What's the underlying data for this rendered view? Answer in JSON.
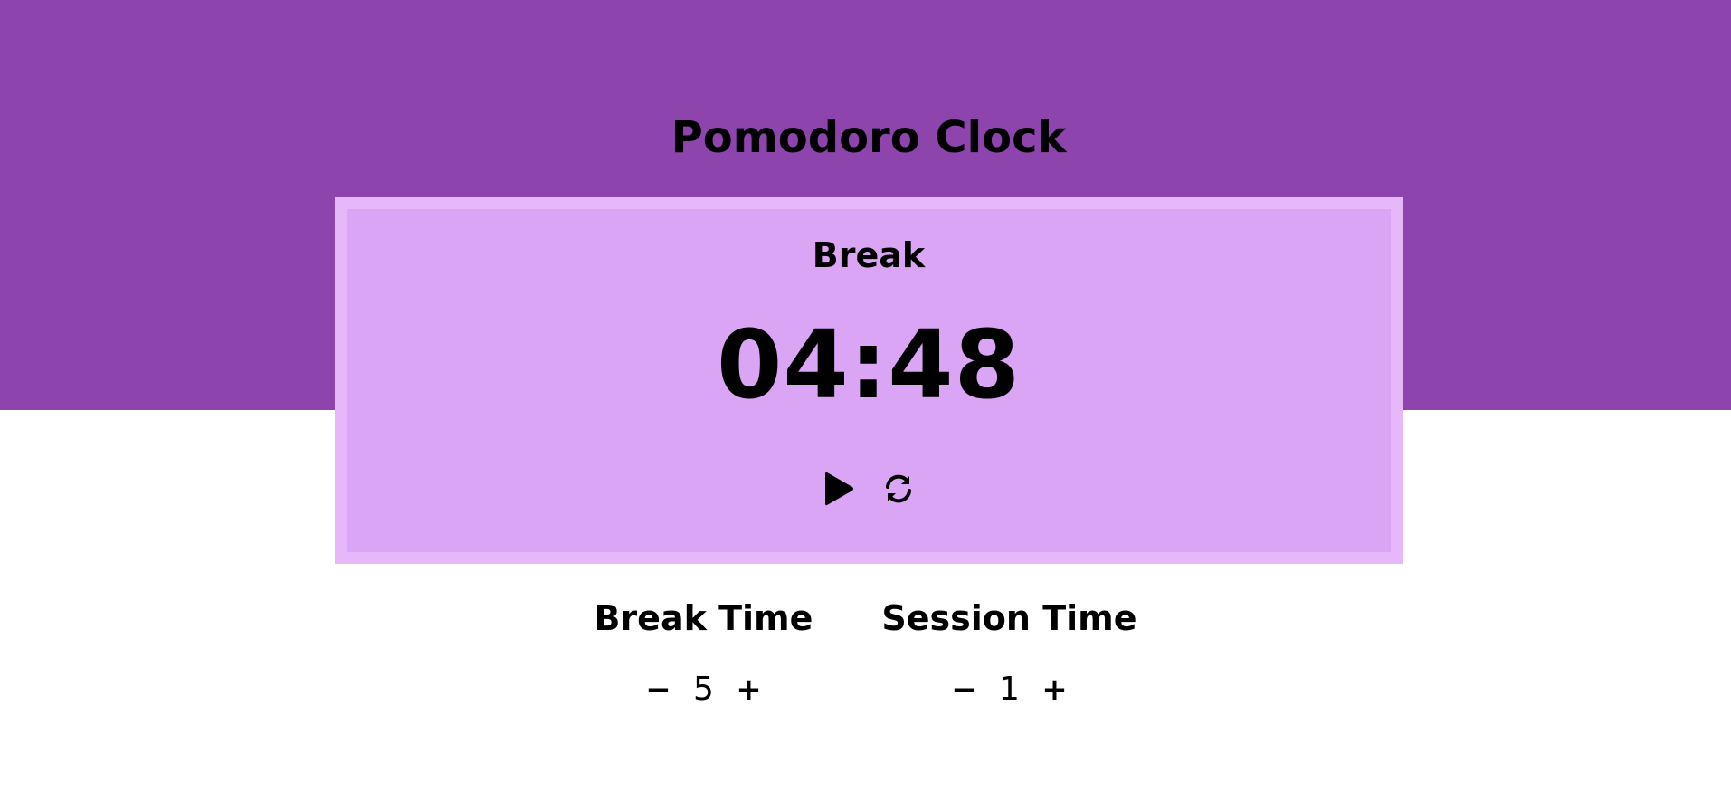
{
  "app": {
    "title": "Pomodoro Clock"
  },
  "clock": {
    "label": "Break",
    "time": "04:48",
    "controls": {
      "play_icon": "play-icon",
      "reset_icon": "refresh-icon"
    }
  },
  "settings": {
    "break": {
      "title": "Break Time",
      "decrement": "−",
      "value": "5",
      "increment": "+"
    },
    "session": {
      "title": "Session Time",
      "decrement": "−",
      "value": "1",
      "increment": "+"
    }
  },
  "colors": {
    "header_band": "#8e44ad",
    "card_fill": "#dba5f6",
    "card_border": "#e6b8fa",
    "page_background": "#ffffff",
    "text": "#000000"
  }
}
